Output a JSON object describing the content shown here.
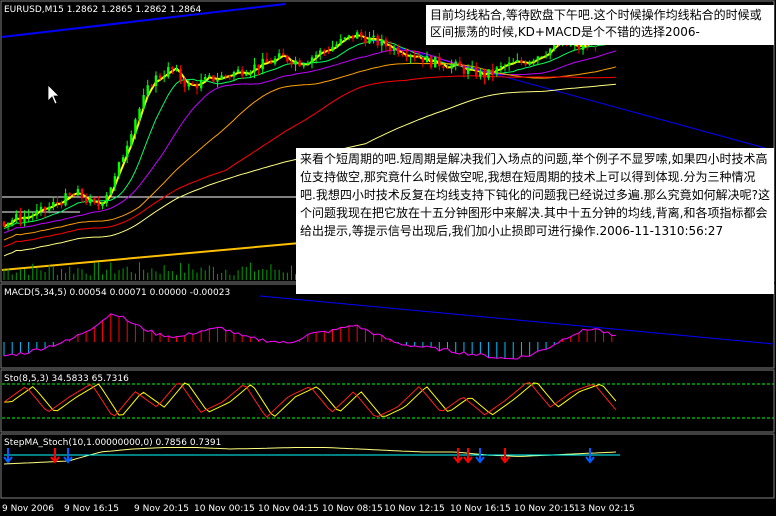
{
  "main": {
    "header": "EURUSD,M15  1.2862 1.2865 1.2862 1.2864"
  },
  "macd": {
    "header": "MACD(5,34,5) 0.00054 0.00071 0.00000 -0.00023"
  },
  "sto": {
    "header": "Sto(8,5,3) 34.5833 65.7316"
  },
  "stepma": {
    "header": "StepMA_Stoch(10,1.00000000,0) 0.7856 0.7391"
  },
  "x_axis": {
    "labels": [
      "9 Nov 2006",
      "9 Nov 16:15",
      "9 Nov 20:15",
      "10 Nov 00:15",
      "10 Nov 04:15",
      "10 Nov 08:15",
      "10 Nov 12:15",
      "10 Nov 16:15",
      "10 Nov 20:15",
      "13 Nov 02:15"
    ]
  },
  "note_top": {
    "text": "目前均线粘合,等待欧盘下午吧.这个时候操作均线粘合的时候或区间振荡的时候,KD+MACD是个不错的选择2006-"
  },
  "note_mid": {
    "text": "来看个短周期的吧.短周期是解决我们入场点的问题,举个例子不显罗嗦,如果四小时技术高位支持做空,那究竟什么时候做空呢,我想在短周期的技术上可以得到体现.分为三种情况吧.我想四小时技术反复在均线支持下钝化的问题我已经说过多遍.那么究竟如何解决呢?这个问题我现在把它放在十五分钟图形中来解决.其中十五分钟的均线,背离,和各项指标都会给出提示,等提示信号出现后,我们加小止损即可进行操作.2006-11-1310:56:27"
  },
  "colors": {
    "background": "#000000",
    "bull_candle": "#00ff00",
    "bear_candle": "#ff0000",
    "trendline": "#0000ff",
    "ma_fast": "#ffff00",
    "ma_slow": "#ffa000",
    "macd_line": "#ff00ff",
    "macd_hist_pos": "#ff0000",
    "macd_hist_neg": "#00c0ff",
    "sto_main": "#ff2020",
    "sto_signal": "#ffff00",
    "stepma_line": "#ffff80",
    "stepma_line2": "#00ffff",
    "level_line": "#00ff00"
  },
  "chart_data": {
    "type": "candlestick",
    "title": "EURUSD,M15",
    "x": [
      "9 Nov 2006",
      "9 Nov 16:15",
      "9 Nov 20:15",
      "10 Nov 00:15",
      "10 Nov 04:15",
      "10 Nov 08:15",
      "10 Nov 12:15",
      "10 Nov 16:15",
      "10 Nov 20:15",
      "13 Nov 02:15"
    ],
    "last": {
      "open": 1.2862,
      "high": 1.2865,
      "low": 1.2862,
      "close": 1.2864
    },
    "price_close_series": [
      0.16,
      0.18,
      0.2,
      0.25,
      0.28,
      0.22,
      0.35,
      0.6,
      0.78,
      0.83,
      0.75,
      0.78,
      0.8,
      0.83,
      0.85,
      0.88,
      0.86,
      0.9,
      0.94,
      0.98,
      0.95,
      0.92,
      0.9,
      0.86,
      0.85,
      0.82,
      0.8,
      0.84,
      0.86,
      0.9,
      0.94,
      0.92,
      0.96,
      0.95
    ],
    "macd_series": [
      0.1,
      0.15,
      0.25,
      0.35,
      0.55,
      0.8,
      0.6,
      0.45,
      0.4,
      0.5,
      0.55,
      0.4,
      0.35,
      0.3,
      0.45,
      0.5,
      0.6,
      0.45,
      0.3,
      0.25,
      0.2,
      0.15,
      0.1,
      0.05,
      0.1,
      0.25,
      0.45,
      0.55,
      0.4
    ],
    "sto_series": [
      0.5,
      0.8,
      0.3,
      0.6,
      0.85,
      0.2,
      0.7,
      0.4,
      0.9,
      0.3,
      0.5,
      0.85,
      0.2,
      0.6,
      0.8,
      0.3,
      0.7,
      0.2,
      0.4,
      0.8,
      0.3,
      0.6,
      0.25,
      0.55,
      0.9,
      0.4,
      0.7,
      0.85,
      0.35
    ],
    "stepma_series": [
      0.2,
      0.25,
      0.3,
      0.6,
      0.7,
      0.75,
      0.75,
      0.7,
      0.72,
      0.75,
      0.75,
      0.7,
      0.65,
      0.6,
      0.6,
      0.5,
      0.45,
      0.5,
      0.55,
      0.6
    ]
  }
}
